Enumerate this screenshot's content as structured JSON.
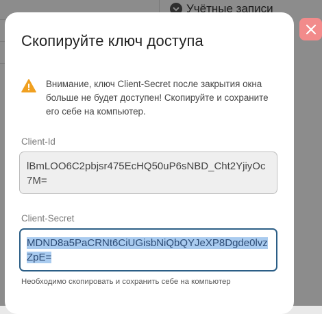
{
  "background": {
    "nav_item_label": "Учётные записи"
  },
  "modal": {
    "title": "Скопируйте ключ доступа",
    "warning_text": "Внимание, ключ Client-Secret после закрытия окна больше не будет доступен! Скопируйте и сохраните его себе на компьютер.",
    "client_id": {
      "label": "Client-Id",
      "value": "lBmLOO6C2pbjsr475EcHQ50uP6sNBD_Cht2YjiyOc7M="
    },
    "client_secret": {
      "label": "Client-Secret",
      "value": "MDND8a5PaCRNt6CiUGisbNiQbQYJeXP8Dgde0lvzZpE="
    },
    "hint": "Необходимо скопировать и сохранить себе на компьютер"
  },
  "colors": {
    "accent_border": "#2b5e86",
    "selection": "#a9cbef",
    "warning": "#f0a020",
    "close_button": "#f28b8b"
  },
  "icons": {
    "warning": "warning-triangle-icon",
    "close": "close-icon",
    "nav": "chevron-down-icon"
  }
}
